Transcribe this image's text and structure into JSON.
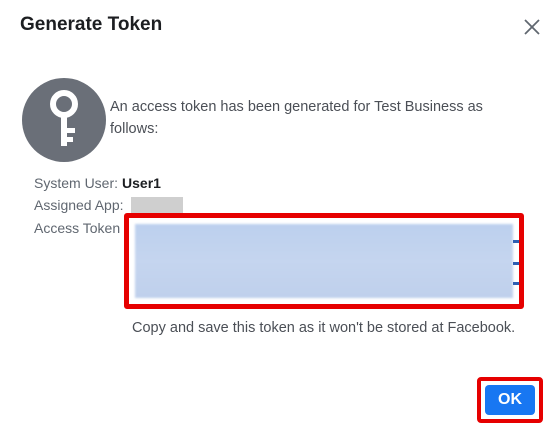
{
  "dialog": {
    "title": "Generate Token",
    "intro": "An access token has been generated for Test Business as follows:",
    "system_user_label": "System User:",
    "system_user_value": "User1",
    "assigned_app_label": "Assigned App:",
    "access_token_label": "Access Token",
    "note": "Copy and save this token as it won't be stored at Facebook.",
    "ok_label": "OK"
  },
  "colors": {
    "ok_button": "#1877f2",
    "highlight_border": "#e60000",
    "key_circle": "#6a6f78"
  },
  "icons": {
    "close": "close-icon",
    "key": "key-icon"
  }
}
